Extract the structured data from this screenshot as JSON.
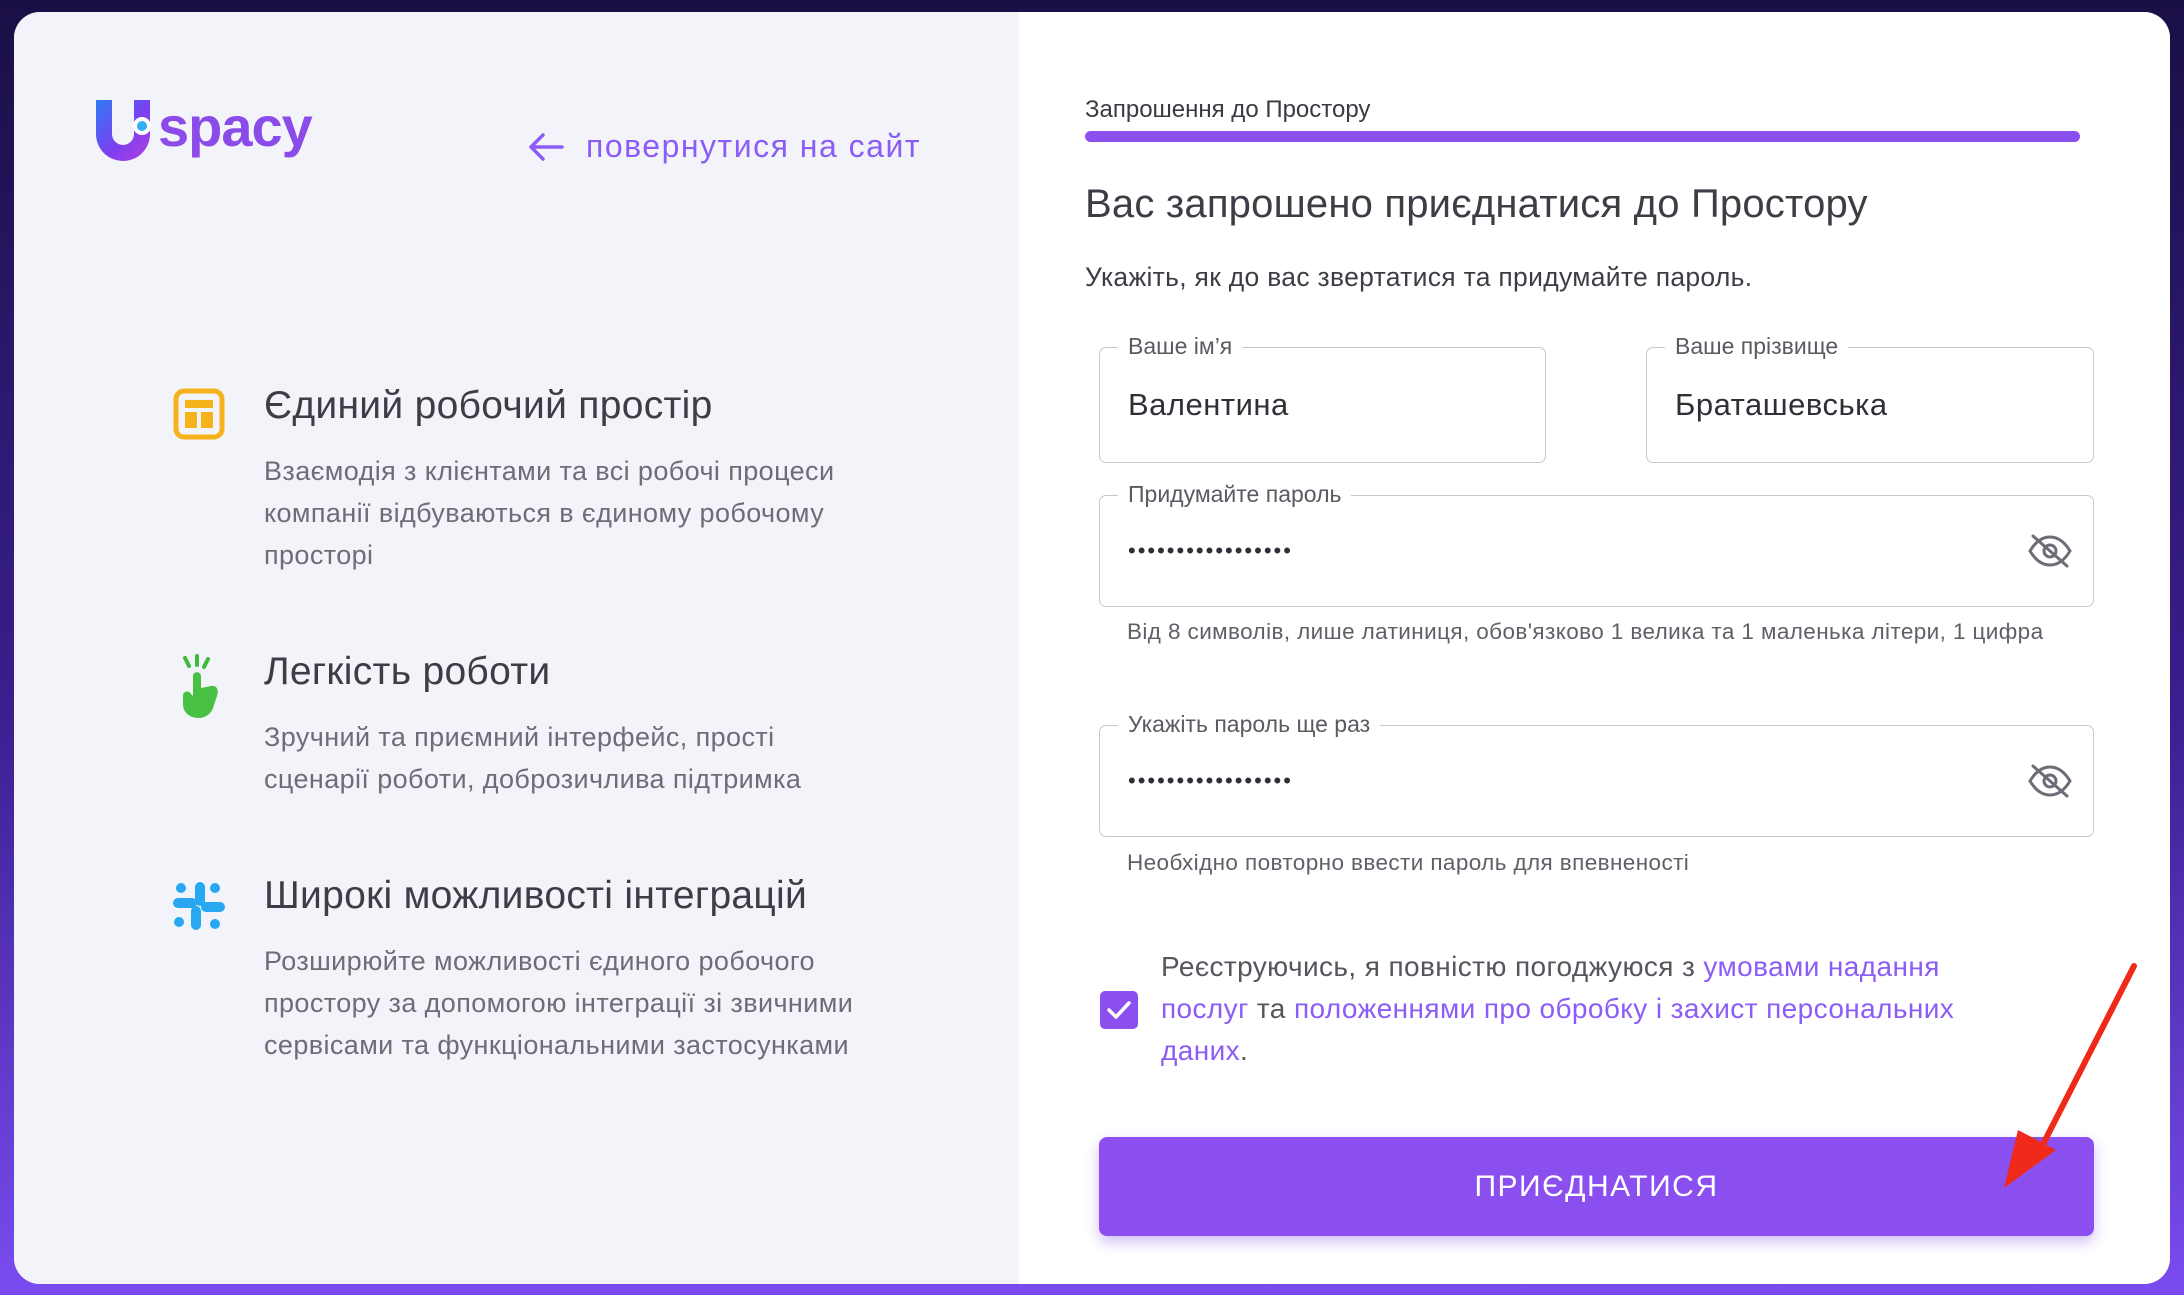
{
  "brand": {
    "logo_text": "spacy",
    "accent": "#8b4ff0"
  },
  "header": {
    "back_link": "повернутися на сайт"
  },
  "features": [
    {
      "icon": "layout-icon",
      "title": "Єдиний робочий простір",
      "text": "Взаємодія з клієнтами та всі робочі процеси компанії відбуваються в єдиному робочому просторі"
    },
    {
      "icon": "hand-click-icon",
      "title": "Легкість роботи",
      "text": "Зручний та приємний інтерфейс, прості сценарії роботи, доброзичлива підтримка"
    },
    {
      "icon": "integration-icon",
      "title": "Широкі можливості інтеграцій",
      "text": "Розширюйте можливості єдиного робочого простору за допомогою інтеграції зі звичними сервісами та функціональними застосунками"
    }
  ],
  "form": {
    "step_label": "Запрошення до Простору",
    "title": "Вас запрошено приєднатися до Простору",
    "subtitle": "Укажіть, як до вас звертатися та придумайте пароль.",
    "first_name": {
      "label": "Ваше ім’я",
      "value": "Валентина"
    },
    "last_name": {
      "label": "Ваше прізвище",
      "value": "Браташевська"
    },
    "password": {
      "label": "Придумайте пароль",
      "value": "•••••••••••••••••",
      "hint": "Від 8 символів, лише латиниця, обов'язково 1 велика та 1 маленька літери, 1 цифра"
    },
    "password_repeat": {
      "label": "Укажіть пароль ще раз",
      "value": "•••••••••••••••••",
      "hint": "Необхідно повторно ввести пароль для впевненості"
    },
    "terms": {
      "checked": true,
      "prefix": "Реєструючись, я повністю погоджуюся з ",
      "link1": "умовами надання послуг",
      "middle": " та ",
      "link2": "положеннями про обробку і захист персональних даних",
      "suffix": "."
    },
    "submit_label": "ПРИЄДНАТИСЯ"
  }
}
